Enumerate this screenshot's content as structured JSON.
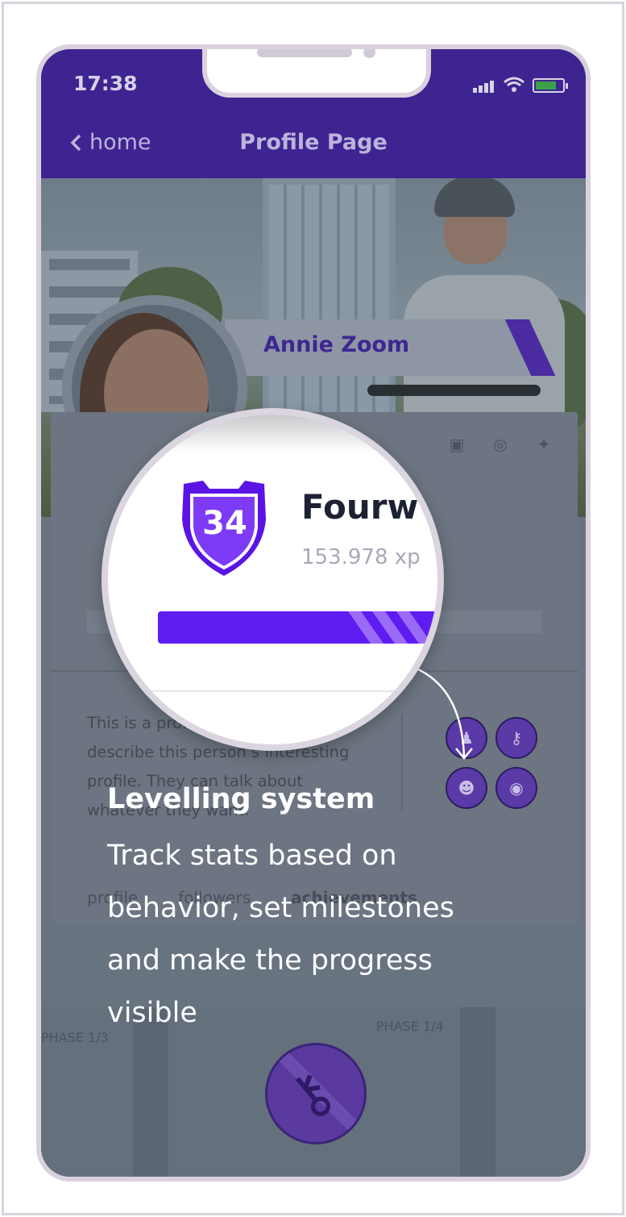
{
  "status_bar": {
    "time": "17:38"
  },
  "nav": {
    "back_label": "home",
    "title": "Profile Page"
  },
  "profile": {
    "name": "Annie Zoom",
    "level": "34",
    "name_partial": "Fourw",
    "xp": "153.978 xp",
    "description": "This is a profile description to describe this person’s interesting profile. They can talk about whatever they want.",
    "social_icons": [
      "twitch-icon",
      "instagram-icon",
      "twitter-icon"
    ],
    "badges": [
      "person-badge-icon",
      "key-badge-icon",
      "group-badge-icon",
      "coins-badge-icon"
    ],
    "tabs": [
      {
        "label": "profile",
        "active": false
      },
      {
        "label": "followers",
        "active": false
      },
      {
        "label": "achievements",
        "active": true
      }
    ]
  },
  "phases": {
    "left": "PHASE 1/3",
    "right": "PHASE 1/4"
  },
  "overlay": {
    "title": "Levelling system",
    "body": "Track stats based on behavior, set milestones and make the progress visible"
  },
  "colors": {
    "brand_purple": "#3e2490",
    "progress_purple": "#5f1cf0",
    "overlay_text": "#ffffff"
  }
}
